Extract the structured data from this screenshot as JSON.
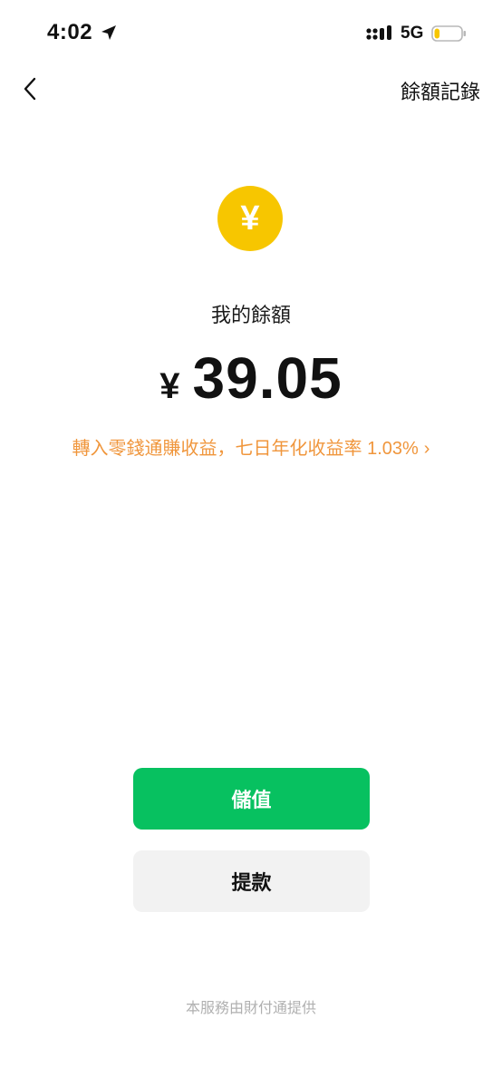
{
  "status_bar": {
    "time": "4:02",
    "network": "5G",
    "location_icon": "location-arrow-icon",
    "signal_icon": "signal-bars-icon",
    "battery_icon": "battery-low-icon",
    "battery_level": 0.2,
    "battery_color": "#f7c600"
  },
  "nav": {
    "back_icon": "chevron-left-icon",
    "history_label": "餘額記錄"
  },
  "balance": {
    "coin_symbol": "¥",
    "coin_color": "#f7c600",
    "label": "我的餘額",
    "currency": "¥",
    "amount": "39.05"
  },
  "promo": {
    "text": "轉入零錢通賺收益，七日年化收益率 1.03%",
    "chevron": "›",
    "color": "#f0963c"
  },
  "actions": {
    "topup_label": "儲值",
    "topup_color": "#07c160",
    "withdraw_label": "提款"
  },
  "footer": {
    "note": "本服務由財付通提供"
  }
}
